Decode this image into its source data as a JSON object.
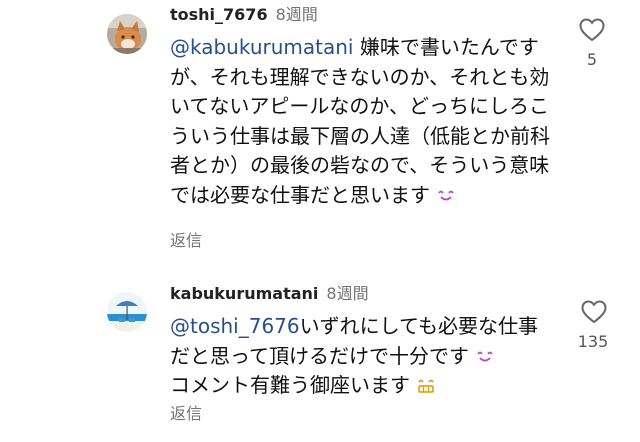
{
  "comments": [
    {
      "username": "toshi_7676",
      "time": "8週間",
      "mention": "@kabukurumatani",
      "text": " 嫌味で書いたんですが、それも理解できないのか、それとも効いてないアピールなのか、どっちにしろこういう仕事は最下層の人達（低能とか前科者とか）の最後の砦なので、そういう意味では必要な仕事だと思います",
      "emoji": "smiling-face-icon",
      "reply_label": "返信",
      "likes": "5"
    },
    {
      "username": "kabukurumatani",
      "time": "8週間",
      "mention": "@toshi_7676",
      "text": "いずれにしても必要な仕事だと思って頂けるだけで十分です",
      "text2": "コメント有難う御座います",
      "emoji": "smiling-face-icon",
      "emoji2": "grinning-face-icon",
      "reply_label": "返信",
      "likes": "135"
    }
  ]
}
